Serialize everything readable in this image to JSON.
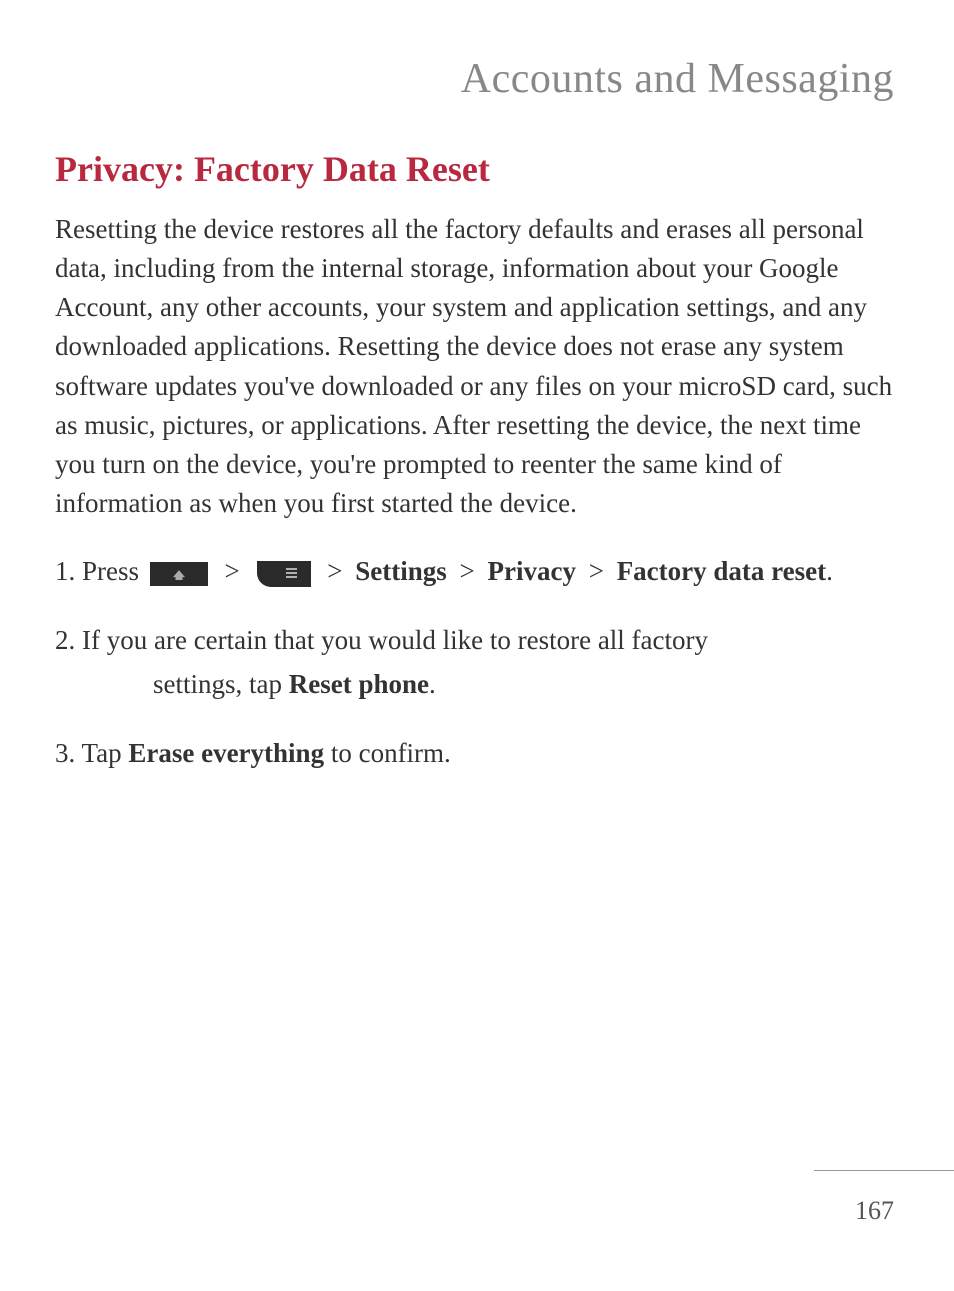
{
  "page": {
    "title": "Accounts and Messaging",
    "number": "167"
  },
  "section": {
    "heading": "Privacy: Factory Data Reset",
    "body": "Resetting the device restores all the factory defaults and erases all personal data, including from the internal storage, information about your Google Account, any other accounts, your system and application settings, and any downloaded applications. Resetting the device does not erase any system software updates you've downloaded or any files on your microSD card, such as music, pictures, or applications. After resetting the device, the next time you turn on the device, you're prompted to reenter the same kind of information as when you first started the device."
  },
  "steps": {
    "s1": {
      "num": "1.",
      "prefix": "Press ",
      "gt1": ">",
      "gt2": ">",
      "settings": "Settings",
      "gt3": ">",
      "privacy": "Privacy",
      "gt4": ">",
      "factory": "Factory data reset",
      "period": "."
    },
    "s2": {
      "num": "2.",
      "line1": "If you are certain that you would like to restore all factory",
      "line2a": "settings, tap ",
      "bold": "Reset phone",
      "line2b": "."
    },
    "s3": {
      "num": "3.",
      "prefix": "Tap ",
      "bold": "Erase everything",
      "suffix": " to confirm."
    }
  }
}
